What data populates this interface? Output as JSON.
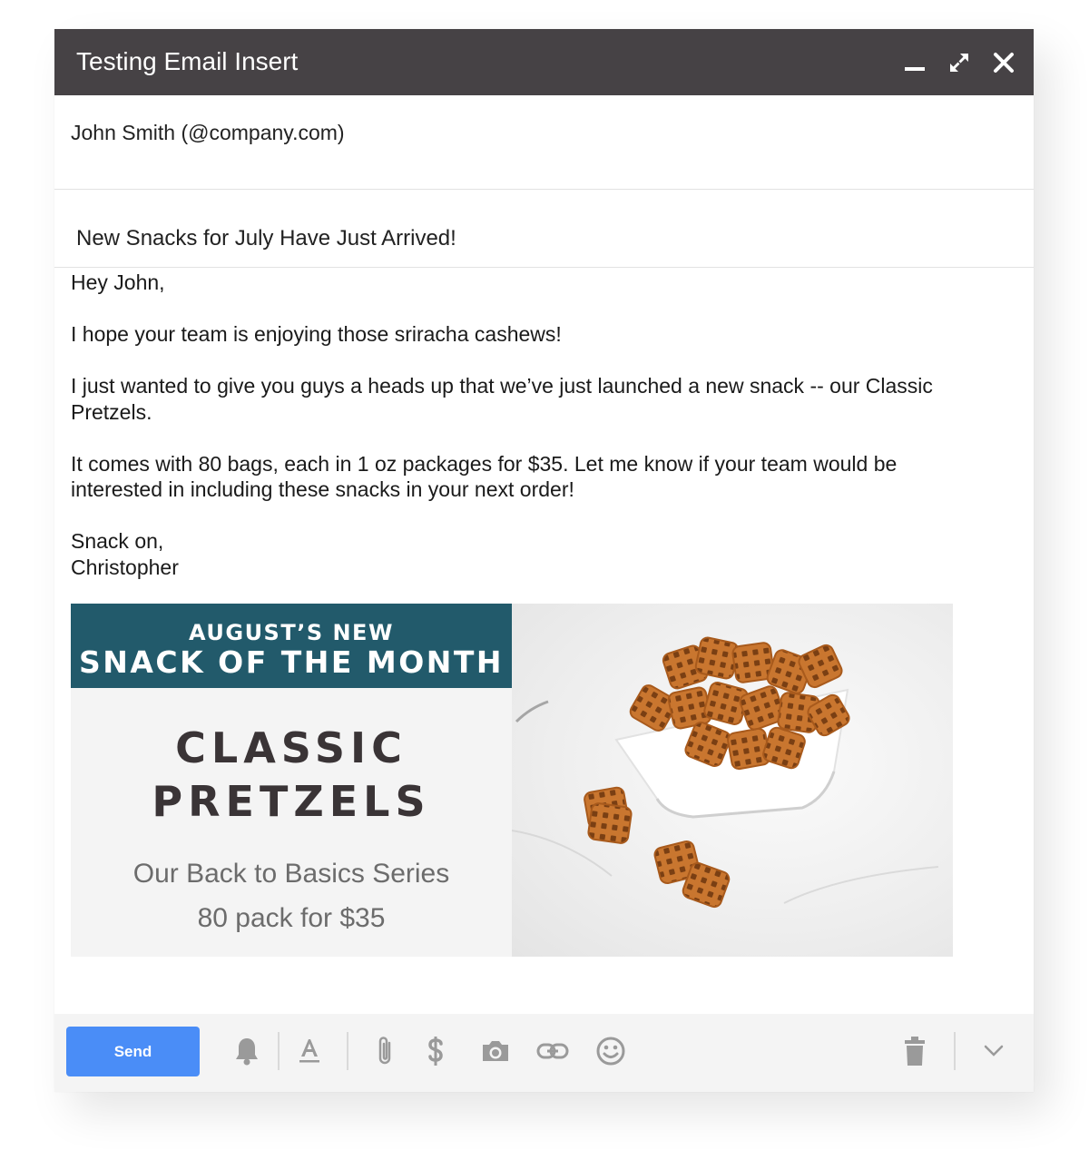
{
  "window": {
    "title": "Testing Email Insert"
  },
  "compose": {
    "to": "John Smith (@company.com)",
    "subject": "New Snacks for July Have Just Arrived!"
  },
  "body": {
    "greeting": "Hey John,",
    "p1": "I hope your team is enjoying those sriracha cashews!",
    "p2": "I just wanted to give you guys a heads up that we’ve just launched a new snack -- our Classic Pretzels.",
    "p3": "It comes with 80 bags, each in 1 oz packages for $35. Let me know if your team would be interested in including these snacks in your next order!",
    "signoff": "Snack on,",
    "signature": "Christopher"
  },
  "banner": {
    "kicker": "AUGUST’S NEW",
    "headline": "SNACK OF THE MONTH",
    "product_line1": "CLASSIC",
    "product_line2": "PRETZELS",
    "series": "Our Back to Basics Series",
    "price": "80 pack for $35",
    "colors": {
      "header_bg": "#225a6b",
      "panel_bg": "#f4f4f4",
      "product_text": "#3a3436"
    }
  },
  "toolbar": {
    "send_label": "Send",
    "send_color": "#4a8df7",
    "icons": [
      "bell-icon",
      "text-format-icon",
      "paperclip-icon",
      "dollar-icon",
      "camera-icon",
      "link-icon",
      "emoji-icon",
      "trash-icon",
      "chevron-down-icon"
    ]
  }
}
